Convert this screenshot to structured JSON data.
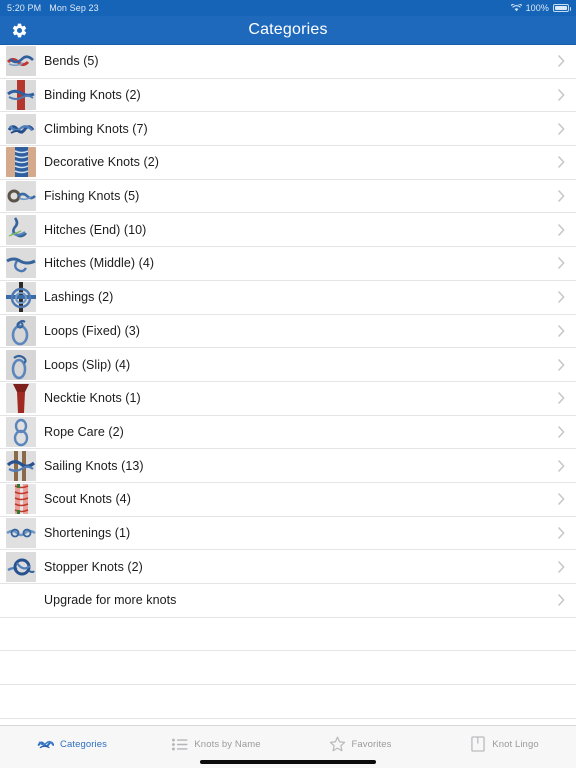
{
  "status_bar": {
    "time": "5:20 PM",
    "date": "Mon Sep 23",
    "wifi_icon": "wifi-icon",
    "battery_percent": "100%",
    "battery_icon": "battery-full-icon"
  },
  "nav_bar": {
    "title": "Categories",
    "settings_icon": "gear-icon"
  },
  "list": {
    "rows": [
      {
        "label": "Bends (5)",
        "thumb": "bends-thumbnail",
        "chevron": "chevron-right-icon"
      },
      {
        "label": "Binding Knots (2)",
        "thumb": "binding-knots-thumbnail",
        "chevron": "chevron-right-icon"
      },
      {
        "label": "Climbing Knots (7)",
        "thumb": "climbing-knots-thumbnail",
        "chevron": "chevron-right-icon"
      },
      {
        "label": "Decorative Knots (2)",
        "thumb": "decorative-knots-thumbnail",
        "chevron": "chevron-right-icon"
      },
      {
        "label": "Fishing Knots (5)",
        "thumb": "fishing-knots-thumbnail",
        "chevron": "chevron-right-icon"
      },
      {
        "label": "Hitches (End) (10)",
        "thumb": "hitches-end-thumbnail",
        "chevron": "chevron-right-icon"
      },
      {
        "label": "Hitches (Middle) (4)",
        "thumb": "hitches-middle-thumbnail",
        "chevron": "chevron-right-icon"
      },
      {
        "label": "Lashings (2)",
        "thumb": "lashings-thumbnail",
        "chevron": "chevron-right-icon"
      },
      {
        "label": "Loops (Fixed) (3)",
        "thumb": "loops-fixed-thumbnail",
        "chevron": "chevron-right-icon"
      },
      {
        "label": "Loops (Slip) (4)",
        "thumb": "loops-slip-thumbnail",
        "chevron": "chevron-right-icon"
      },
      {
        "label": "Necktie Knots (1)",
        "thumb": "necktie-knots-thumbnail",
        "chevron": "chevron-right-icon"
      },
      {
        "label": "Rope Care (2)",
        "thumb": "rope-care-thumbnail",
        "chevron": "chevron-right-icon"
      },
      {
        "label": "Sailing Knots (13)",
        "thumb": "sailing-knots-thumbnail",
        "chevron": "chevron-right-icon"
      },
      {
        "label": "Scout Knots (4)",
        "thumb": "scout-knots-thumbnail",
        "chevron": "chevron-right-icon"
      },
      {
        "label": "Shortenings (1)",
        "thumb": "shortenings-thumbnail",
        "chevron": "chevron-right-icon"
      },
      {
        "label": "Stopper Knots (2)",
        "thumb": "stopper-knots-thumbnail",
        "chevron": "chevron-right-icon"
      }
    ],
    "upgrade_row": {
      "label": "Upgrade for more knots",
      "chevron": "chevron-right-icon"
    },
    "empty_row_count": 4
  },
  "tab_bar": {
    "tabs": [
      {
        "label": "Categories",
        "icon": "knot-icon",
        "active": true
      },
      {
        "label": "Knots by Name",
        "icon": "list-icon",
        "active": false
      },
      {
        "label": "Favorites",
        "icon": "star-icon",
        "active": false
      },
      {
        "label": "Knot Lingo",
        "icon": "book-icon",
        "active": false
      }
    ]
  },
  "colors": {
    "nav_bar": "#1f69bd",
    "status_bar": "#1664b8",
    "accent": "#2f6fc0",
    "separator": "#e4e4e6",
    "chevron": "#c7c7cc",
    "tab_inactive": "#9b9b9f",
    "tab_bar_bg": "#f7f7f7"
  }
}
